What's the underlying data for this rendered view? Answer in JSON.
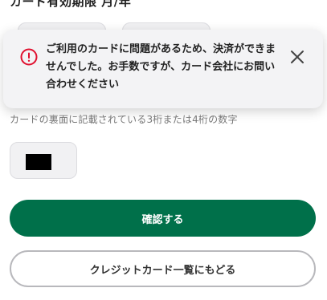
{
  "expiry": {
    "label": "カード有効期限 月/年"
  },
  "error_toast": {
    "message": "ご利用のカードに問題があるため、決済ができませんでした。お手数ですが、カード会社にお問い合わせください",
    "icon": "error-circle-icon",
    "close_icon": "close-icon",
    "accent_color": "#e0102f"
  },
  "cvv": {
    "label": "カードの裏面に記載されている3桁または4桁の数字"
  },
  "actions": {
    "confirm_label": "確認する",
    "back_label": "クレジットカード一覧にもどる"
  },
  "colors": {
    "primary": "#00704a",
    "error": "#e0102f"
  }
}
